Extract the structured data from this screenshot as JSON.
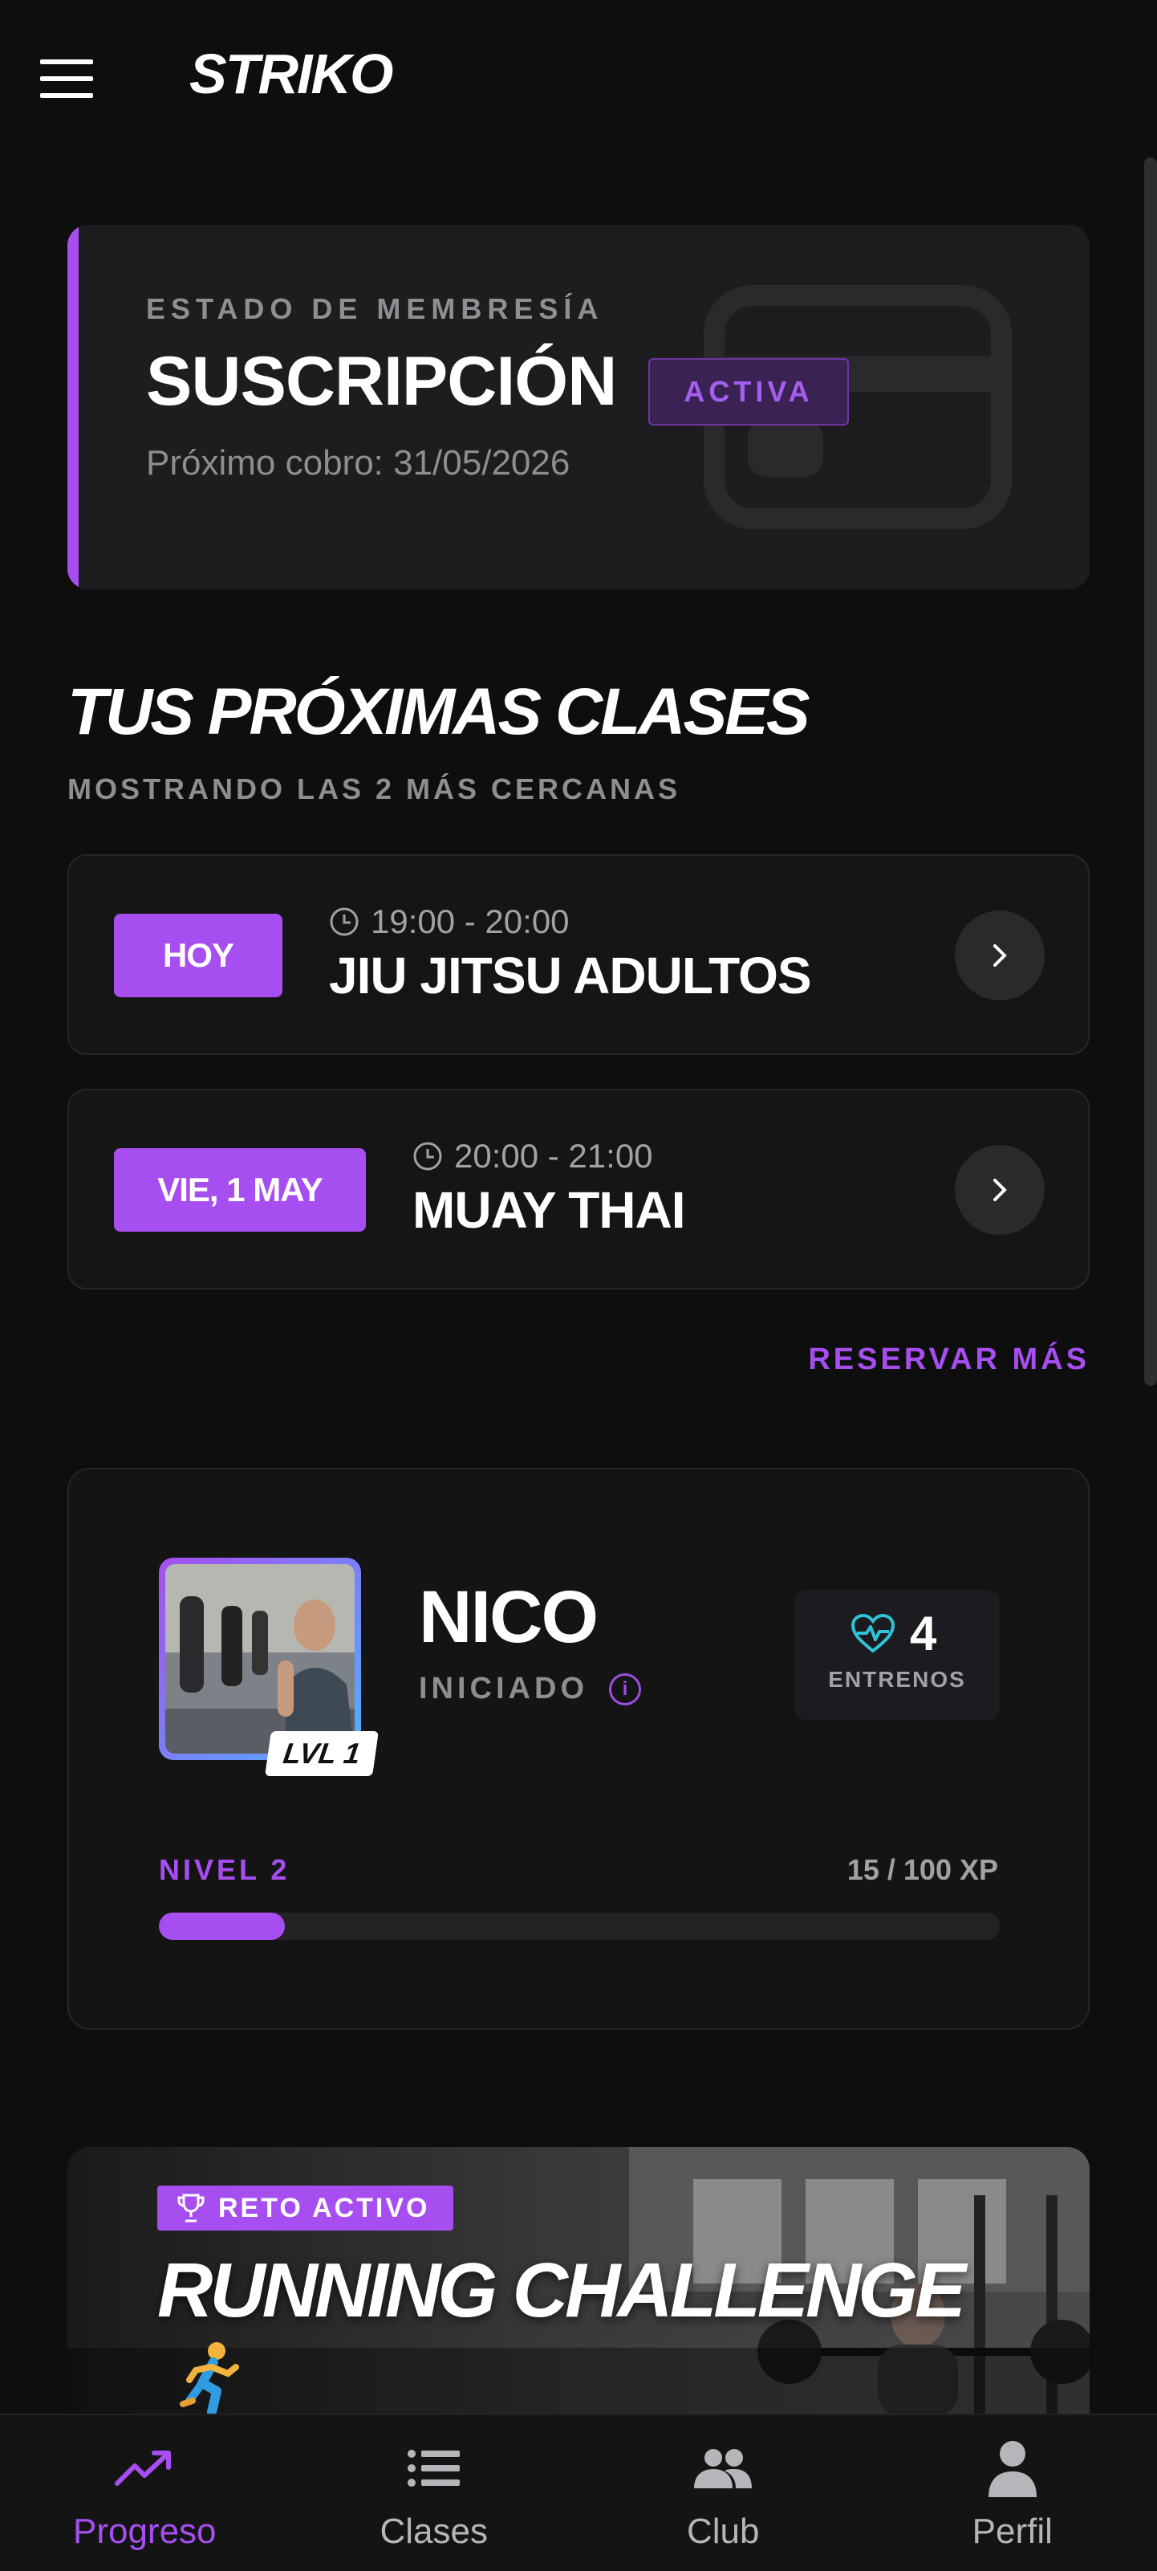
{
  "app": {
    "logo": "STRIKO"
  },
  "membership": {
    "kicker": "ESTADO DE MEMBRESÍA",
    "title": "SUSCRIPCIÓN",
    "status": "ACTIVA",
    "next_charge": "Próximo cobro: 31/05/2026"
  },
  "upcoming": {
    "title": "TUS PRÓXIMAS CLASES",
    "subtitle": "MOSTRANDO LAS 2 MÁS CERCANAS",
    "classes": [
      {
        "day": "HOY",
        "time": "19:00 - 20:00",
        "name": "JIU JITSU ADULTOS"
      },
      {
        "day": "VIE, 1 MAY",
        "time": "20:00 - 21:00",
        "name": "MUAY THAI"
      }
    ],
    "more_label": "RESERVAR MÁS"
  },
  "profile": {
    "name": "NICO",
    "rank": "INICIADO",
    "level_badge": "LVL 1",
    "trainings_count": "4",
    "trainings_label": "ENTRENOS",
    "next_level": "NIVEL 2",
    "xp_text": "15 / 100 XP",
    "xp_progress": 0.15
  },
  "challenge": {
    "badge": "RETO ACTIVO",
    "title": "RUNNING CHALLENGE",
    "emoji": "🏃"
  },
  "tabs": [
    {
      "label": "Progreso",
      "icon": "trending-up-icon",
      "active": true
    },
    {
      "label": "Clases",
      "icon": "list-icon",
      "active": false
    },
    {
      "label": "Club",
      "icon": "group-icon",
      "active": false
    },
    {
      "label": "Perfil",
      "icon": "person-icon",
      "active": false
    }
  ],
  "colors": {
    "accent": "#a74ef0",
    "background": "#0e0e0f",
    "card": "#1d1d1f",
    "heart": "#2ec4d6"
  }
}
